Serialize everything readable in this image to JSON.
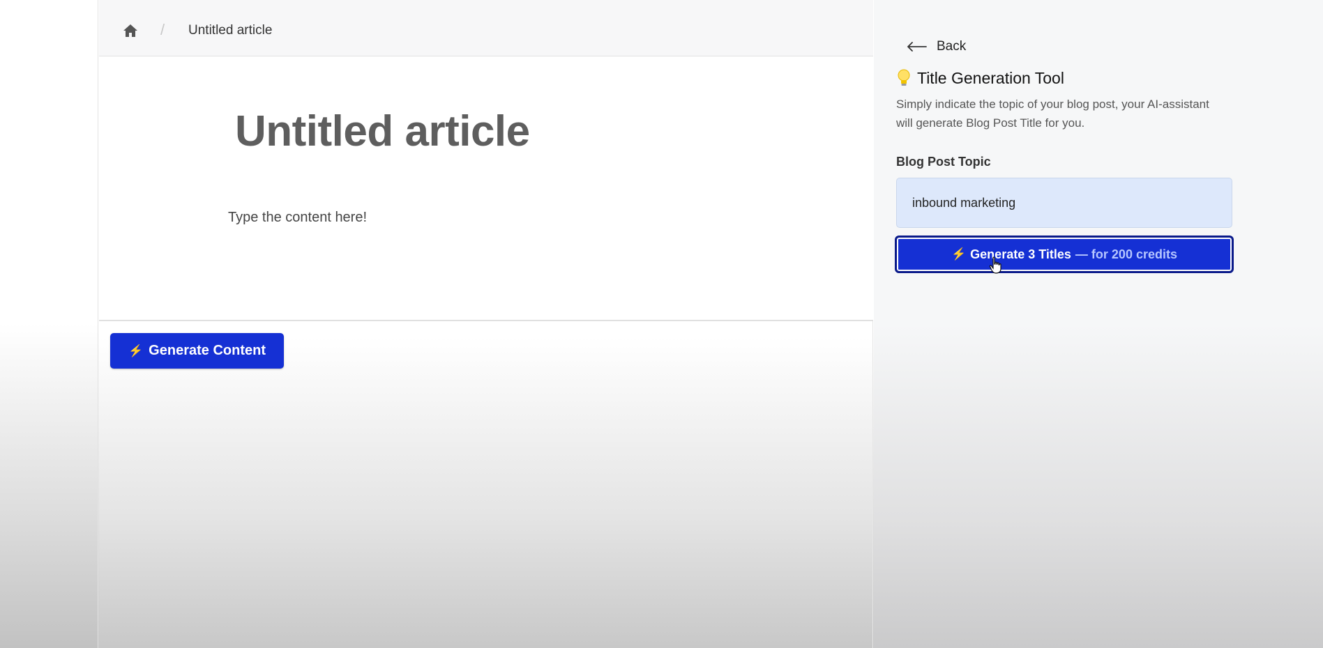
{
  "breadcrumb": {
    "separator": "/",
    "current": "Untitled article"
  },
  "article": {
    "title": "Untitled article",
    "body_placeholder": "Type the content here!"
  },
  "editor_actions": {
    "generate_content_label": "Generate Content"
  },
  "panel": {
    "back_label": "Back",
    "tool_title": "Title Generation Tool",
    "tool_description": "Simply indicate the topic of your blog post, your AI-assistant will generate Blog Post Title for you.",
    "field_label": "Blog Post Topic",
    "topic_value": "inbound marketing",
    "generate_button_main": "Generate 3 Titles",
    "generate_button_credits": "— for 200 credits"
  },
  "icons": {
    "home": "home-icon",
    "back": "arrow-left-icon",
    "bulb": "lightbulb-icon",
    "bolt": "lightning-bolt-icon",
    "cursor": "hand-pointer-icon"
  },
  "colors": {
    "primary_button": "#1530d4",
    "input_background": "#dde8fb",
    "credits_text": "#b6c6ff",
    "bolt": "#ffd54a"
  }
}
